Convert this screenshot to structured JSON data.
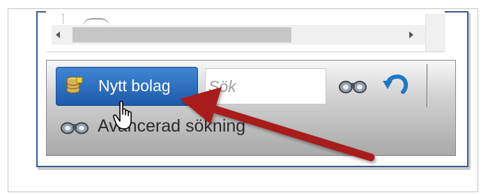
{
  "toolbar": {
    "new_company_label": "Nytt bolag",
    "search_placeholder": "Sök",
    "search_value": "",
    "advanced_search_label": "Avancerad sökning"
  },
  "icons": {
    "new_company": "database-icon",
    "search": "binoculars-icon",
    "refresh": "refresh-icon",
    "advanced_search": "binoculars-icon",
    "cursor": "hand-pointer-cursor",
    "annotation": "red-arrow-annotation"
  },
  "colors": {
    "button_blue": "#2a6cbf",
    "panel_border": "#3a5a92",
    "arrow_red": "#a81e1e"
  }
}
